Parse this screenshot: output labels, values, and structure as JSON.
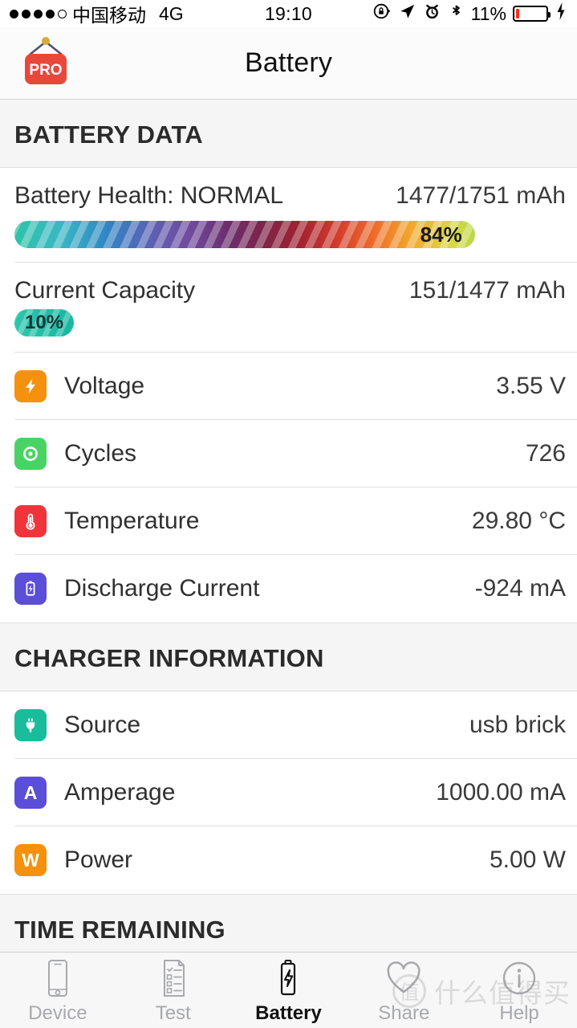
{
  "status_bar": {
    "signal_dots_filled": 4,
    "signal_dots_total": 5,
    "carrier": "中国移动",
    "network": "4G",
    "time": "19:10",
    "battery_percent": "11%",
    "battery_level": 11,
    "icons": [
      "rotation-lock-icon",
      "location-arrow-icon",
      "alarm-clock-icon",
      "bluetooth-icon",
      "charging-bolt-icon"
    ]
  },
  "navbar": {
    "title": "Battery",
    "badge_label": "PRO",
    "badge_color": "#e8483c",
    "pin_color": "#d9a93a"
  },
  "sections": [
    {
      "id": "battery-data",
      "title": "BATTERY DATA"
    },
    {
      "id": "charger-information",
      "title": "CHARGER INFORMATION"
    },
    {
      "id": "time-remaining",
      "title": "TIME REMAINING"
    }
  ],
  "battery_data": {
    "health": {
      "label": "Battery Health: NORMAL",
      "value": "1477/1751 mAh",
      "percent_label": "84%",
      "percent": 84
    },
    "capacity": {
      "label": "Current Capacity",
      "value": "151/1477 mAh",
      "percent_label": "10%",
      "percent": 10,
      "badge_color": "#1abc9c"
    },
    "rows": [
      {
        "icon": "lightning-bolt-icon",
        "icon_color": "#f5910d",
        "label": "Voltage",
        "value": "3.55 V"
      },
      {
        "icon": "cycle-refresh-icon",
        "icon_color": "#4ad365",
        "label": "Cycles",
        "value": "726"
      },
      {
        "icon": "thermometer-icon",
        "icon_color": "#f0343c",
        "label": "Temperature",
        "value": "29.80 °C"
      },
      {
        "icon": "battery-icon",
        "icon_color": "#5b4ed8",
        "label": "Discharge Current",
        "value": "-924 mA"
      }
    ]
  },
  "charger_information": {
    "rows": [
      {
        "icon": "plug-icon",
        "icon_color": "#1abc9c",
        "label": "Source",
        "value": "usb brick"
      },
      {
        "icon": "amperage-icon",
        "icon_color": "#5b4ed8",
        "icon_letter": "A",
        "label": "Amperage",
        "value": "1000.00 mA"
      },
      {
        "icon": "power-icon",
        "icon_color": "#f5910d",
        "icon_letter": "W",
        "label": "Power",
        "value": "5.00 W"
      }
    ]
  },
  "tabbar": {
    "active": "Battery",
    "tabs": [
      {
        "label": "Device",
        "icon": "phone-icon"
      },
      {
        "label": "Test",
        "icon": "checklist-icon"
      },
      {
        "label": "Battery",
        "icon": "battery-bolt-icon"
      },
      {
        "label": "Share",
        "icon": "heart-icon"
      },
      {
        "label": "Help",
        "icon": "info-circle-icon"
      }
    ]
  },
  "watermark": {
    "mark": "值",
    "text": "什么值得买"
  }
}
